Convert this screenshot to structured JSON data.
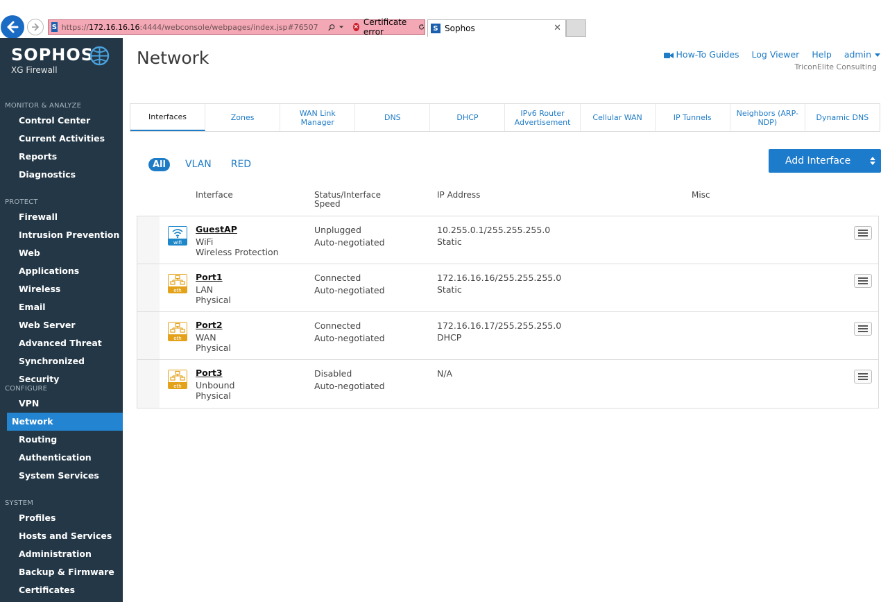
{
  "browser": {
    "url_prefix": "https://",
    "url_host": "172.16.16.16",
    "url_suffix": ":4444/webconsole/webpages/index.jsp#76507",
    "cert_error": "Certificate error",
    "tab_title": "Sophos",
    "favicon_letter": "S"
  },
  "sidebar": {
    "brand": "SOPHOS",
    "product": "XG Firewall",
    "sections": [
      {
        "heading": "MONITOR & ANALYZE",
        "items": [
          "Control Center",
          "Current Activities",
          "Reports",
          "Diagnostics"
        ]
      },
      {
        "heading": "PROTECT",
        "items": [
          "Firewall",
          "Intrusion Prevention",
          "Web",
          "Applications",
          "Wireless",
          "Email",
          "Web Server",
          "Advanced Threat",
          "Synchronized Security"
        ]
      },
      {
        "heading": "CONFIGURE",
        "items": [
          "VPN",
          "Network",
          "Routing",
          "Authentication",
          "System Services"
        ]
      },
      {
        "heading": "SYSTEM",
        "items": [
          "Profiles",
          "Hosts and Services",
          "Administration",
          "Backup & Firmware",
          "Certificates"
        ]
      }
    ],
    "active_item": "Network"
  },
  "header": {
    "title": "Network",
    "links": {
      "howto": "How-To Guides",
      "logviewer": "Log Viewer",
      "help": "Help",
      "admin": "admin"
    },
    "company": "TriconElite Consulting"
  },
  "tabs": [
    "Interfaces",
    "Zones",
    "WAN Link Manager",
    "DNS",
    "DHCP",
    "IPv6 Router Advertisement",
    "Cellular WAN",
    "IP Tunnels",
    "Neighbors (ARP-NDP)",
    "Dynamic DNS"
  ],
  "active_tab": "Interfaces",
  "filters": [
    "All",
    "VLAN",
    "RED"
  ],
  "active_filter": "All",
  "add_button": "Add Interface",
  "columns": {
    "interface": "Interface",
    "status": "Status/Interface Speed",
    "ip": "IP Address",
    "misc": "Misc"
  },
  "rows": [
    {
      "icon": "wifi",
      "icon_label": "wifi",
      "name": "GuestAP",
      "line2": "WiFi",
      "line3": "Wireless Protection",
      "status": "Unplugged",
      "speed": "Auto-negotiated",
      "ip": "10.255.0.1/255.255.255.0",
      "mode": "Static"
    },
    {
      "icon": "eth",
      "icon_label": "eth",
      "name": "Port1",
      "line2": "LAN",
      "line3": "Physical",
      "status": "Connected",
      "speed": "Auto-negotiated",
      "ip": "172.16.16.16/255.255.255.0",
      "mode": "Static"
    },
    {
      "icon": "eth",
      "icon_label": "eth",
      "name": "Port2",
      "line2": "WAN",
      "line3": "Physical",
      "status": "Connected",
      "speed": "Auto-negotiated",
      "ip": "172.16.16.17/255.255.255.0",
      "mode": "DHCP"
    },
    {
      "icon": "eth",
      "icon_label": "eth",
      "name": "Port3",
      "line2": "Unbound",
      "line3": "Physical",
      "status": "Disabled",
      "speed": "Auto-negotiated",
      "ip": "N/A",
      "mode": ""
    }
  ],
  "colors": {
    "sidebar": "#233746",
    "accent": "#1e7bc6",
    "wifi_icon": "#1d87c9",
    "eth_icon": "#e3a21a"
  }
}
